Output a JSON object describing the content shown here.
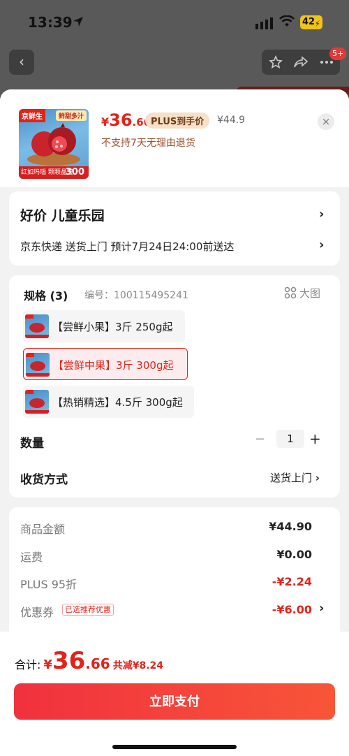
{
  "status_bar": {
    "time": "13:39",
    "battery": "42"
  },
  "nav": {
    "badge": "5+"
  },
  "product": {
    "thumb_brand": "京鲜生",
    "thumb_tag": "鲜甜多汁",
    "thumb_bottom_left": "红如玛瑙 颗颗晶莹",
    "thumb_bottom_right": "300",
    "price_currency": "¥",
    "price_int": "36",
    "price_dec": ".66",
    "plus_tag": "PLUS到手价",
    "original_price": "¥44.9",
    "return_policy": "不支持7天无理由退货",
    "close": "×"
  },
  "store": {
    "name": "好价 儿童乐园",
    "delivery": "京东快递 送货上门 预计7月24日24:00前送达"
  },
  "spec": {
    "title": "规格 (3)",
    "code": "编号：100115495241",
    "big_image": "大图",
    "options": [
      {
        "label": "【尝鲜小果】3斤 250g起",
        "selected": false
      },
      {
        "label": "【尝鲜中果】3斤 300g起",
        "selected": true
      },
      {
        "label": "【热销精选】4.5斤 300g起",
        "selected": false
      }
    ],
    "qty_label": "数量",
    "qty_minus": "−",
    "qty_value": "1",
    "qty_plus": "+",
    "ship_label": "收货方式",
    "ship_value": "送货上门"
  },
  "summary": {
    "rows": [
      {
        "label": "商品金额",
        "value": "¥44.90",
        "red": false
      },
      {
        "label": "运费",
        "value": "¥0.00",
        "red": false
      },
      {
        "label": "PLUS 95折",
        "value": "-¥2.24",
        "red": true
      },
      {
        "label": "优惠券",
        "value": "-¥6.00",
        "red": true
      }
    ],
    "coupon_tag": "已选推荐优惠"
  },
  "footer": {
    "total_label": "合计:",
    "total_currency": "¥",
    "total_int": "36",
    "total_dec": ".66",
    "total_saving": "共减¥8.24",
    "pay_button": "立即支付"
  },
  "colors": {
    "accent": "#e2231a",
    "plus_tag_bg": "#f6e0c8"
  }
}
